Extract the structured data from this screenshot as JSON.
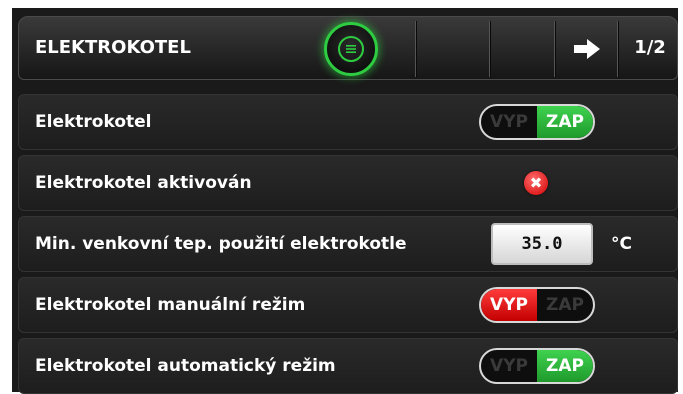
{
  "header": {
    "title": "ELEKTROKOTEL",
    "page_indicator": "1/2",
    "menu_icon": "menu-icon",
    "next_icon": "arrow-right-icon"
  },
  "rows": [
    {
      "label": "Elektrokotel",
      "type": "toggle",
      "off_label": "VYP",
      "on_label": "ZAP",
      "state": "ZAP"
    },
    {
      "label": "Elektrokotel aktivován",
      "type": "status",
      "status_icon": "error-x-icon"
    },
    {
      "label": "Min. venkovní tep. použití elektrokotle",
      "type": "input",
      "value": "35.0",
      "unit": "°C"
    },
    {
      "label": "Elektrokotel manuální režim",
      "type": "toggle",
      "off_label": "VYP",
      "on_label": "ZAP",
      "state": "VYP"
    },
    {
      "label": "Elektrokotel automatický režim",
      "type": "toggle",
      "off_label": "VYP",
      "on_label": "ZAP",
      "state": "ZAP"
    }
  ],
  "colors": {
    "accent_green": "#2ecc40",
    "toggle_on_green": "#2fb83d",
    "toggle_off_red": "#e01010",
    "status_error_red": "#d10000",
    "panel_background": "#1a1a1a"
  }
}
